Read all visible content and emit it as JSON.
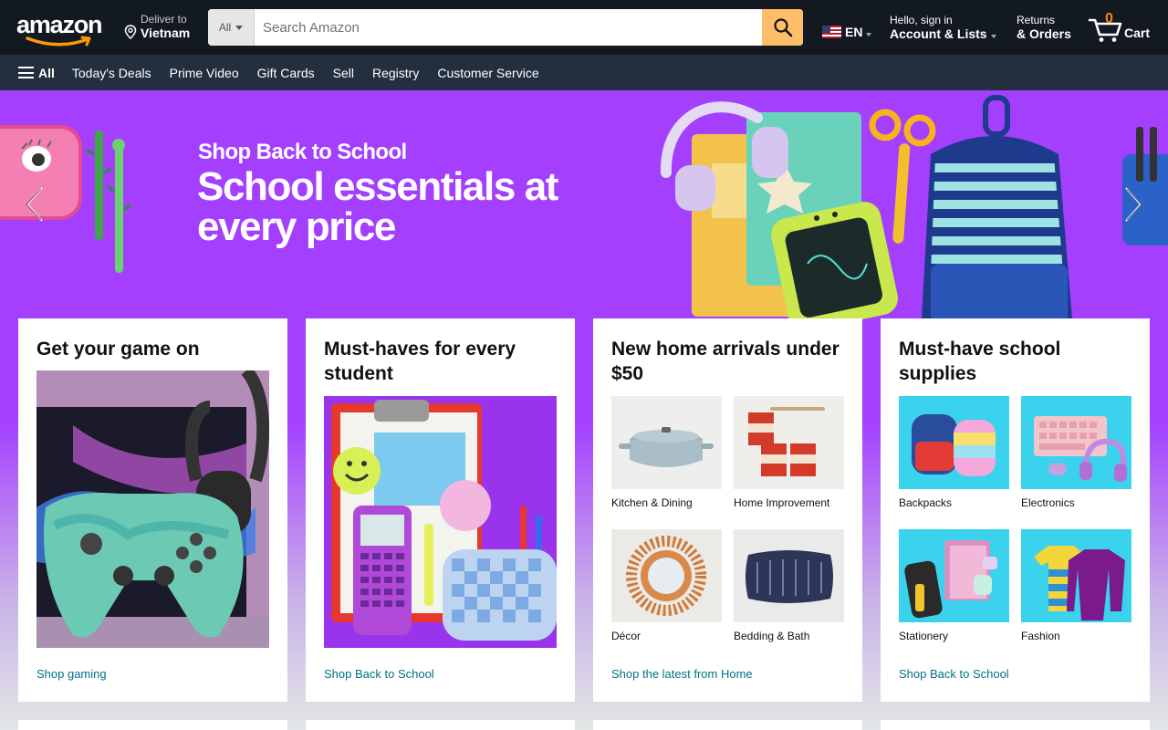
{
  "header": {
    "logo_text": "amazon",
    "deliver_line1": "Deliver to",
    "deliver_line2": "Vietnam",
    "search_category": "All",
    "search_placeholder": "Search Amazon",
    "language": "EN",
    "account_line1": "Hello, sign in",
    "account_line2": "Account & Lists",
    "returns_line1": "Returns",
    "returns_line2": "& Orders",
    "cart_count": "0",
    "cart_label": "Cart",
    "colors": {
      "nav_bg": "#131921",
      "subnav_bg": "#232f3e",
      "search_button": "#febd69",
      "cart_count": "#f08804"
    }
  },
  "subnav": {
    "all_label": "All",
    "links": [
      "Today's Deals",
      "Prime Video",
      "Gift Cards",
      "Sell",
      "Registry",
      "Customer Service"
    ]
  },
  "hero": {
    "subtitle": "Shop Back to School",
    "title": "School essentials at every price",
    "background": "#a33ffd"
  },
  "cards": [
    {
      "title": "Get your game on",
      "link": "Shop gaming",
      "image": "gaming-controller-headphones"
    },
    {
      "title": "Must-haves for every student",
      "link": "Shop Back to School",
      "image": "school-supplies-calculator"
    },
    {
      "title": "New home arrivals under $50",
      "link": "Shop the latest from Home",
      "items": [
        {
          "label": "Kitchen & Dining",
          "image": "dutch-oven"
        },
        {
          "label": "Home Improvement",
          "image": "paint-cans"
        },
        {
          "label": "Décor",
          "image": "sunburst-mirror"
        },
        {
          "label": "Bedding & Bath",
          "image": "pillow"
        }
      ]
    },
    {
      "title": "Must-have school supplies",
      "link": "Shop Back to School",
      "items": [
        {
          "label": "Backpacks",
          "image": "backpacks"
        },
        {
          "label": "Electronics",
          "image": "keyboard-headphones"
        },
        {
          "label": "Stationery",
          "image": "notebooks"
        },
        {
          "label": "Fashion",
          "image": "kids-shirts"
        }
      ]
    }
  ],
  "link_color": "#007185"
}
